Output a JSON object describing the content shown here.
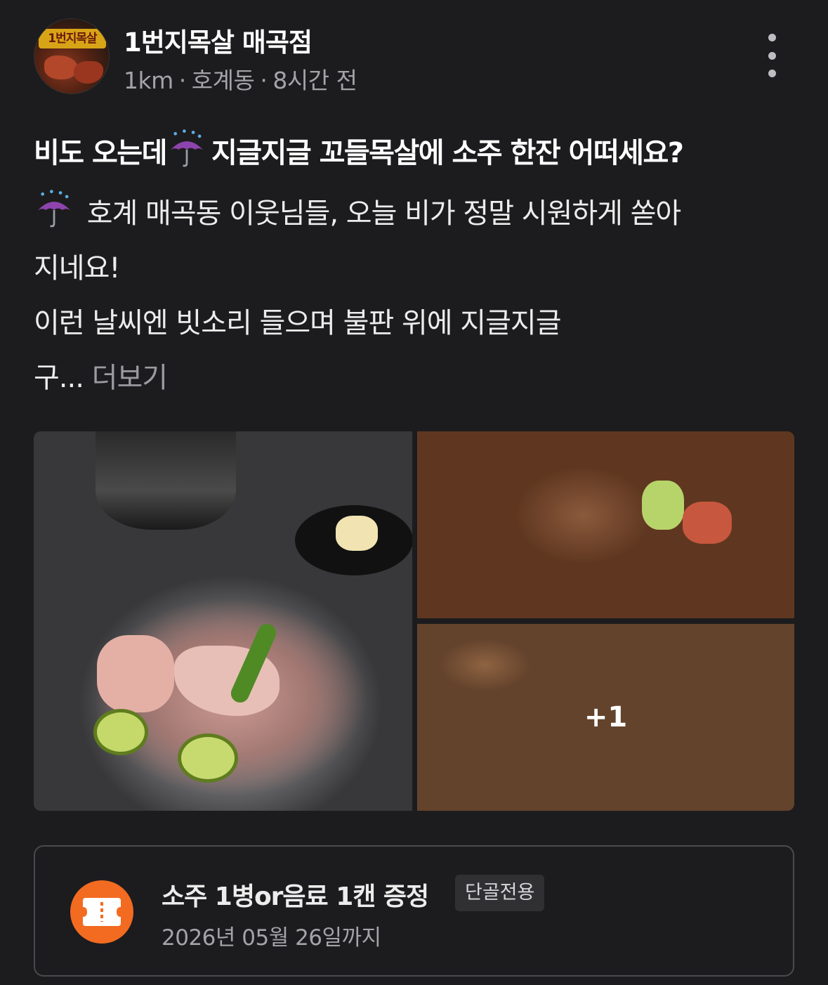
{
  "store": {
    "name": "1번지목살 매곡점",
    "avatar_logo_text": "1번지목살",
    "distance": "1km",
    "neighborhood": "호계동",
    "time_ago": "8시간 전"
  },
  "post": {
    "title_before": "비도 오는데",
    "title_emoji": "umbrella-with-rain-icon",
    "title_after": "지글지글 꼬들목살에 소주 한잔 어떠세요?",
    "body_line1": "호계 매곡동 이웃님들, 오늘 비가 정말 시원하게 쏟아",
    "body_line2": "지네요!",
    "body_line3": "이런 날씨엔 빗소리 들으며 불판 위에 지글지글",
    "body_line4": "구...",
    "more_label": "더보기"
  },
  "photos": {
    "images": [
      "grilled-pork-neck-on-grill",
      "pork-wrapped-in-perilla-leaf",
      "grilled-pork-pieces"
    ],
    "extra_count_label": "+1"
  },
  "coupon": {
    "icon": "ticket-icon",
    "title": "소주 1병or음료 1캔 증정",
    "tag": "단골전용",
    "expiry": "2026년 05월 26일까지"
  },
  "colors": {
    "background": "#1c1c1e",
    "text_primary": "#ffffff",
    "text_secondary": "#a3a3a8",
    "accent": "#f26b21",
    "umbrella": "#8e44ad"
  }
}
